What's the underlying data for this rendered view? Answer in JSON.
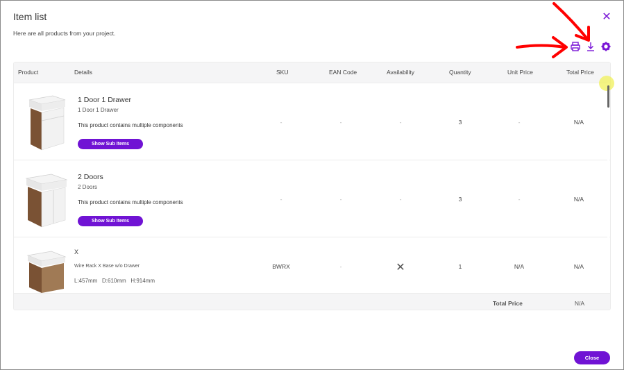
{
  "dialog": {
    "title": "Item list",
    "subtitle": "Here are all products from your project.",
    "close_icon": "close-icon",
    "close_button_label": "Close"
  },
  "toolbar": {
    "icons": [
      "print-icon",
      "download-icon",
      "settings-gear-icon"
    ]
  },
  "table": {
    "headers": {
      "product": "Product",
      "details": "Details",
      "sku": "SKU",
      "ean": "EAN Code",
      "availability": "Availability",
      "quantity": "Quantity",
      "unit_price": "Unit Price",
      "total_price": "Total Price"
    },
    "rows": [
      {
        "name": "1 Door 1 Drawer",
        "description": "1 Door 1 Drawer",
        "note": "This product contains multiple components",
        "button": "Show Sub Items",
        "sku": "-",
        "ean": "-",
        "availability": "-",
        "quantity": "3",
        "unit_price": "-",
        "total_price": "N/A"
      },
      {
        "name": "2 Doors",
        "description": "2 Doors",
        "note": "This product contains multiple components",
        "button": "Show Sub Items",
        "sku": "-",
        "ean": "-",
        "availability": "-",
        "quantity": "3",
        "unit_price": "-",
        "total_price": "N/A"
      },
      {
        "name": "X",
        "description": "Wire Rack X Base w/o Drawer",
        "dimensions": "L:457mm   D:610mm   H:914mm",
        "sku": "BWRX",
        "ean": "-",
        "availability_icon": "unavailable-x-icon",
        "quantity": "1",
        "unit_price": "N/A",
        "total_price": "N/A"
      }
    ],
    "footer": {
      "label": "Total Price",
      "value": "N/A"
    }
  },
  "colors": {
    "accent": "#7013d4",
    "annotation_red": "#ff0000",
    "header_bg": "#f5f5f6"
  }
}
